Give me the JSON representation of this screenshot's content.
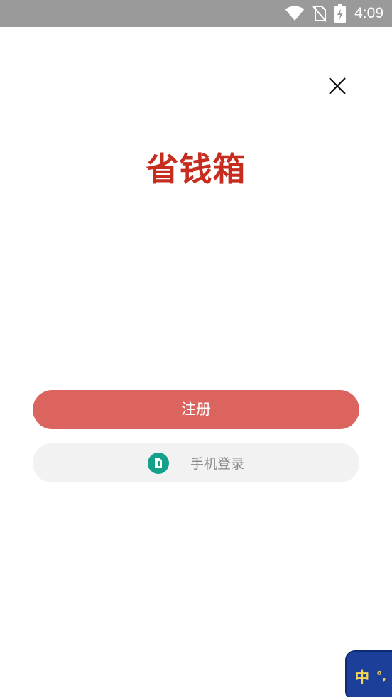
{
  "status_bar": {
    "time": "4:09",
    "icons": [
      "wifi-icon",
      "no-sim-icon",
      "battery-charging-icon"
    ]
  },
  "app": {
    "title": "省钱箱",
    "title_color": "#c62d1f"
  },
  "actions": {
    "register_label": "注册",
    "register_color": "#db655e",
    "phone_login_label": "手机登录",
    "phone_login_icon": "phone-icon",
    "phone_icon_color": "#14a08a"
  },
  "close": {
    "icon": "close-icon"
  },
  "ime": {
    "char": "中",
    "punct": "°,"
  }
}
